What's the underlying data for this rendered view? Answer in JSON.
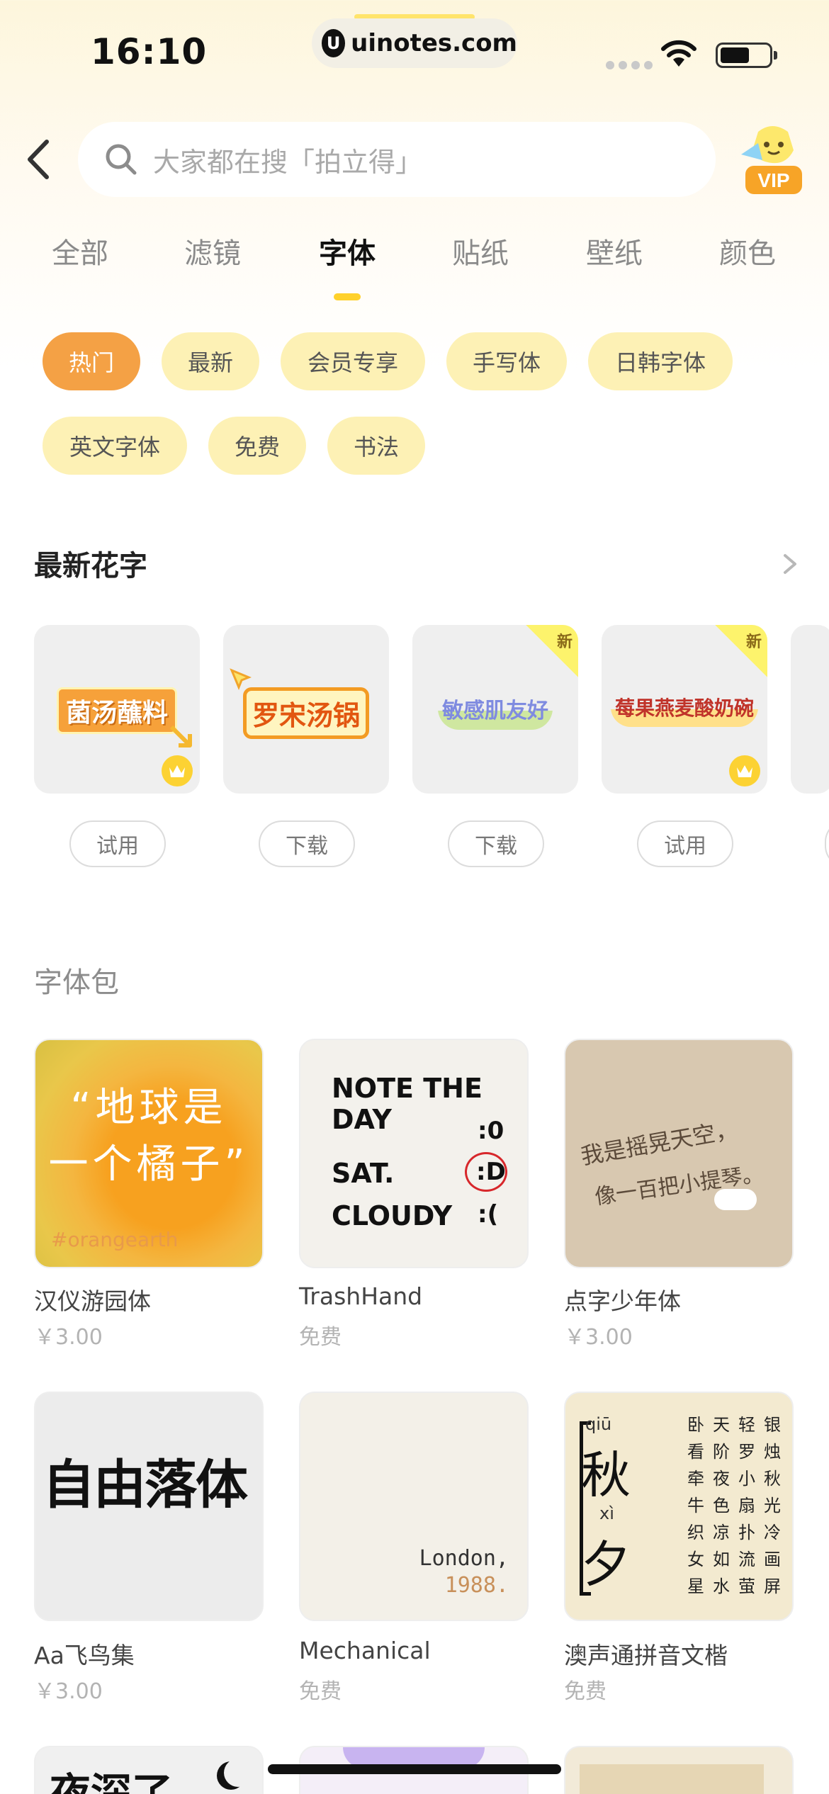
{
  "status_bar": {
    "time": "16:10",
    "url": "uinotes.com",
    "url_icon": "U"
  },
  "header": {
    "search_placeholder": "大家都在搜「拍立得」",
    "vip_label": "VIP"
  },
  "tabs": [
    "全部",
    "滤镜",
    "字体",
    "贴纸",
    "壁纸",
    "颜色"
  ],
  "active_tab": "字体",
  "chips": [
    "热门",
    "最新",
    "会员专享",
    "手写体",
    "日韩字体",
    "英文字体",
    "免费",
    "书法"
  ],
  "active_chip": "热门",
  "section_latest": {
    "title": "最新花字"
  },
  "stickers": [
    {
      "text": "菌汤蘸料",
      "button": "试用",
      "new": false,
      "vip": true
    },
    {
      "text": "罗宋汤锅",
      "button": "下载",
      "new": false,
      "vip": false
    },
    {
      "text": "敏感肌友好",
      "button": "下载",
      "new": true,
      "vip": false
    },
    {
      "text": "莓果燕麦酸奶碗",
      "button": "试用",
      "new": true,
      "vip": true
    }
  ],
  "new_badge": "新",
  "section_fonts": {
    "title": "字体包"
  },
  "font_packs": [
    {
      "name": "汉仪游园体",
      "price": "￥3.00",
      "art_line1": "“地球是",
      "art_line2": "一个橘子”",
      "art_tag": "#orangearth"
    },
    {
      "name": "TrashHand",
      "price": "免费",
      "art_lines": [
        "NOTE THE DAY",
        ":0",
        "SAT.",
        ":D",
        "CLOUDY",
        ":("
      ]
    },
    {
      "name": "点字少年体",
      "price": "￥3.00",
      "art_line1": "我是摇晃天空，",
      "art_line2": "像一百把小提琴。"
    },
    {
      "name": "Aa飞鸟集",
      "price": "￥3.00",
      "art_text": "自由落体"
    },
    {
      "name": "Mechanical",
      "price": "免费",
      "art_line1": "London,",
      "art_line2": "1988."
    },
    {
      "name": "澳声通拼音文楷",
      "price": "免费",
      "art_pinyin1": "qiū",
      "art_big1": "秋",
      "art_pinyin2": "xì",
      "art_big2": "夕",
      "art_cols": [
        "卧看牵牛织女星",
        "天阶夜色凉如水",
        "轻罗小扇扑流萤",
        "银烛秋光冷画屏"
      ]
    }
  ],
  "partial_row": {
    "text": "夜深了"
  }
}
